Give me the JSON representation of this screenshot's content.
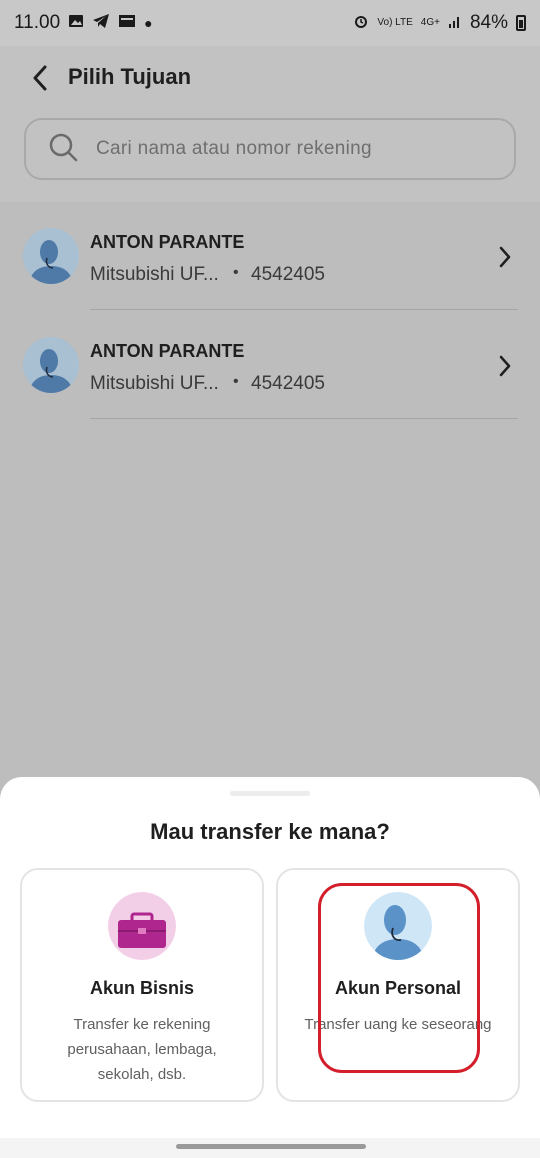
{
  "status_bar": {
    "time": "11.00",
    "network": "4G+",
    "volte": "Vo) LTE",
    "battery": "84%"
  },
  "header": {
    "title": "Pilih Tujuan"
  },
  "search": {
    "placeholder": "Cari nama atau nomor rekening"
  },
  "recipients": [
    {
      "name": "ANTON PARANTE",
      "bank": "Mitsubishi UF...",
      "account": "4542405"
    },
    {
      "name": "ANTON PARANTE",
      "bank": "Mitsubishi UF...",
      "account": "4542405"
    }
  ],
  "sheet": {
    "title": "Mau transfer ke mana?",
    "options": [
      {
        "title": "Akun Bisnis",
        "description": "Transfer ke rekening perusahaan, lembaga, sekolah, dsb.",
        "icon": "briefcase-icon"
      },
      {
        "title": "Akun Personal",
        "description": "Transfer uang ke seseorang",
        "icon": "person-icon"
      }
    ]
  },
  "colors": {
    "highlight": "#d21f2b",
    "business_icon_bg": "#f2cfe6",
    "business_icon": "#b0268f",
    "personal_icon_bg": "#cfe6f7",
    "personal_icon": "#5b93c9"
  }
}
